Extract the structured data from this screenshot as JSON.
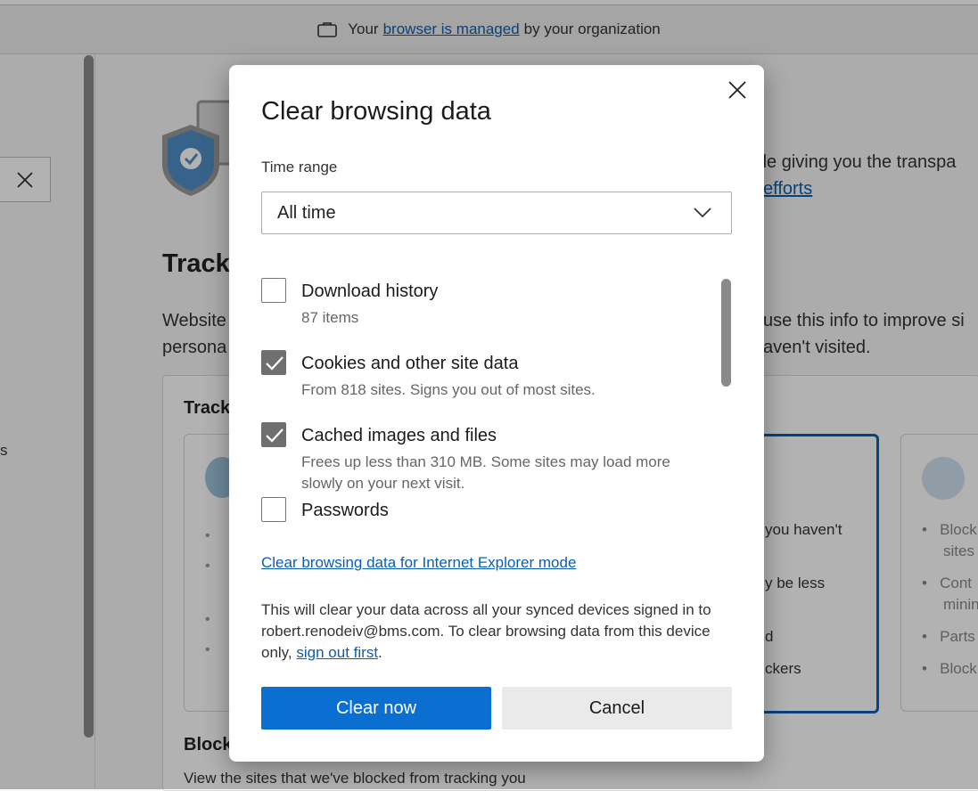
{
  "banner": {
    "prefix": "Your",
    "link": "browser is managed",
    "suffix": "by your organization",
    "icon": "briefcase-icon"
  },
  "background": {
    "left_partial_text": "s",
    "section_title_partial": "Tracki",
    "para_left_line1": "Website",
    "para_left_line2": "persona",
    "right_text_line1": "hile giving you the transpa",
    "right_link": "efforts",
    "right_para_line1": "use this info to improve si",
    "right_para_line2": "aven't visited.",
    "card_title_partial": "Track",
    "card2_lines": [
      "you haven't",
      "y be less",
      "d",
      "ckers"
    ],
    "card3_lines": [
      "Block",
      "sites",
      "Cont",
      "minin",
      "Parts",
      "Block"
    ],
    "blocked_title_partial": "Block",
    "blocked_desc": "View the sites that we've blocked from tracking you"
  },
  "dialog": {
    "title": "Clear browsing data",
    "time_range_label": "Time range",
    "time_range_value": "All time",
    "items": [
      {
        "label": "Download history",
        "desc": "87 items",
        "checked": false
      },
      {
        "label": "Cookies and other site data",
        "desc": "From 818 sites. Signs you out of most sites.",
        "checked": true
      },
      {
        "label": "Cached images and files",
        "desc": "Frees up less than 310 MB. Some sites may load more slowly on your next visit.",
        "checked": true
      },
      {
        "label": "Passwords",
        "desc": "",
        "checked": false
      }
    ],
    "ie_mode_link": "Clear browsing data for Internet Explorer mode",
    "sync_text_before": "This will clear your data across all your synced devices signed in to robert.renodeiv@bms.com. To clear browsing data from this device only,",
    "sync_link": "sign out first",
    "sync_text_after": ".",
    "clear_button": "Clear now",
    "cancel_button": "Cancel"
  },
  "colors": {
    "accent": "#0a6fd1",
    "link": "#0a5fb0",
    "checkbox_checked": "#6f6f6f"
  }
}
